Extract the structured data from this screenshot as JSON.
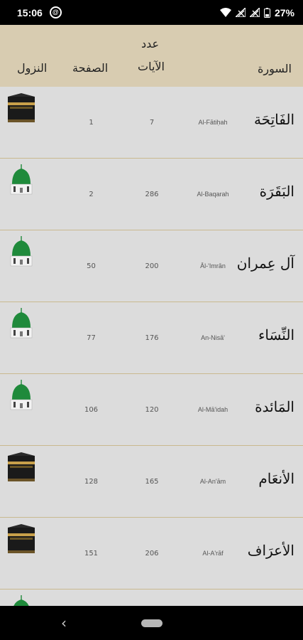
{
  "status_bar": {
    "time": "15:06",
    "battery": "27%"
  },
  "header": {
    "col_revelation": "النزول",
    "col_page": "الصفحة",
    "col_ayat_top": "عدد",
    "col_ayat_bottom": "الآيات",
    "col_surah": "السورة"
  },
  "surahs": [
    {
      "arabic": "الفَاتِحَة",
      "translit": "Al-Fātiḥah",
      "ayat": "7",
      "page": "1",
      "revelation": "kaaba-icon"
    },
    {
      "arabic": "البَقَرَة",
      "translit": "Al-Baqarah",
      "ayat": "286",
      "page": "2",
      "revelation": "mosque-dome-icon"
    },
    {
      "arabic": "آل عِمران",
      "translit": "Āl-'Imrān",
      "ayat": "200",
      "page": "50",
      "revelation": "mosque-dome-icon"
    },
    {
      "arabic": "النِّسَاء",
      "translit": "An-Nisā'",
      "ayat": "176",
      "page": "77",
      "revelation": "mosque-dome-icon"
    },
    {
      "arabic": "المَائدة",
      "translit": "Al-Mā'idah",
      "ayat": "120",
      "page": "106",
      "revelation": "mosque-dome-icon"
    },
    {
      "arabic": "الأنعَام",
      "translit": "Al-An'ām",
      "ayat": "165",
      "page": "128",
      "revelation": "kaaba-icon"
    },
    {
      "arabic": "الأعرَاف",
      "translit": "Al-A'rāf",
      "ayat": "206",
      "page": "151",
      "revelation": "kaaba-icon"
    },
    {
      "arabic": "",
      "translit": "",
      "ayat": "",
      "page": "",
      "revelation": "mosque-dome-icon"
    }
  ],
  "colors": {
    "header_bg": "#d8ccb1",
    "row_bg": "#dcdcdc",
    "divider": "#c9b98f",
    "dome_green": "#1f8a3b",
    "kaaba_gold": "#c8a04a"
  }
}
